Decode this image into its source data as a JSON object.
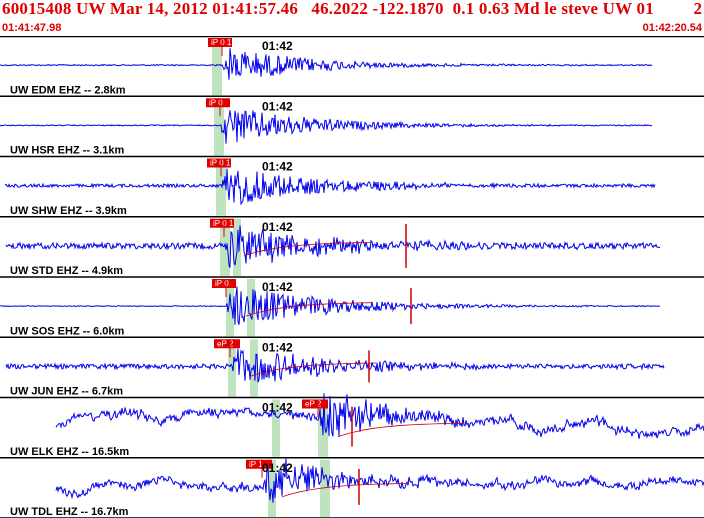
{
  "header": {
    "title": "60015408 UW Mar 14, 2012 01:41:57.46   46.2022 -122.1870  0.1 0.63 Md le steve UW 01",
    "page": "2",
    "start_time": "01:41:47.98",
    "end_time": "01:42:20.54"
  },
  "colors": {
    "title": "#e00000",
    "trace": "#0000ee",
    "pick_box": "#e00000",
    "pick_window": "#bfe3bf",
    "coda_fit": "#cc0000"
  },
  "time_tick_label": "01:42",
  "traces": [
    {
      "label": "UW EDM EHZ -- 2.8km",
      "pick": "iP 0 1",
      "time_tick": "01:42"
    },
    {
      "label": "UW HSR EHZ -- 3.1km",
      "pick": "iP 0",
      "time_tick": "01:42"
    },
    {
      "label": "UW SHW EHZ -- 3.9km",
      "pick": "iP 0 1",
      "time_tick": "01:42"
    },
    {
      "label": "UW STD EHZ -- 4.9km",
      "pick": "iP 0 1",
      "time_tick": "01:42"
    },
    {
      "label": "UW SOS EHZ -- 6.0km",
      "pick": "iP 0",
      "time_tick": "01:42"
    },
    {
      "label": "UW JUN EHZ -- 6.7km",
      "pick": "eP 2",
      "time_tick": "01:42"
    },
    {
      "label": "UW ELK EHZ -- 16.5km",
      "pick": "eP 2",
      "time_tick": "01:42"
    },
    {
      "label": "UW TDL EHZ -- 16.7km",
      "pick": "iP 1",
      "time_tick": "01:42"
    }
  ]
}
